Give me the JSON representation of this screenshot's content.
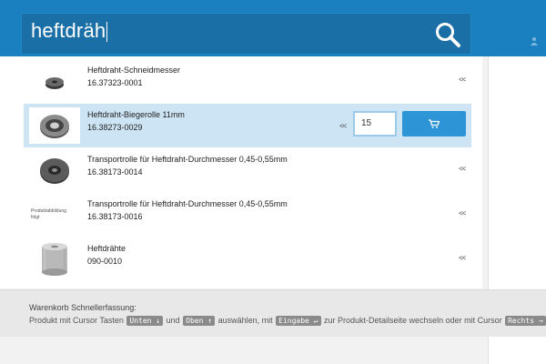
{
  "search": {
    "value": "heftdräh"
  },
  "icons": {
    "search": "search-icon",
    "cart": "cart-icon",
    "user": "user-icon"
  },
  "colors": {
    "header": "#1a80c0",
    "search_bg": "#1a6fa6",
    "selected_row": "#cce4f4",
    "cart_button": "#2d95d6"
  },
  "results": [
    {
      "title": "Heftdraht-Schneidmesser",
      "code": "16.37323-0001",
      "arrow": "<<",
      "selected": false
    },
    {
      "title": "Heftdraht-Biegerolle 11mm",
      "code": "16.38273-0029",
      "arrow": "<<",
      "selected": true,
      "quantity": "15"
    },
    {
      "title": "Transportrolle für Heftdraht-Durchmesser 0,45-0,55mm",
      "code": "16.38173-0014",
      "arrow": "<<",
      "selected": false
    },
    {
      "title": "Transportrolle für Heftdraht-Durchmesser 0,45-0,55mm",
      "code": "16.38173-0016",
      "arrow": "<<",
      "selected": false,
      "placeholder_text": [
        "Produktabbildung",
        "folgt"
      ]
    },
    {
      "title": "Heftdrähte",
      "code": "090-0010",
      "arrow": "<<",
      "selected": false
    }
  ],
  "footer": {
    "title": "Warenkorb Schnellerfassung:",
    "t1": "Produkt mit Cursor Tasten",
    "k_down": "Unten ↓",
    "t2": "und",
    "k_up": "Oben ↑",
    "t3": "auswählen, mit",
    "k_enter": "Eingabe ↵",
    "t4": "zur Produkt-Detailseite wechseln oder mit Cursor",
    "k_right": "Rechts →"
  }
}
